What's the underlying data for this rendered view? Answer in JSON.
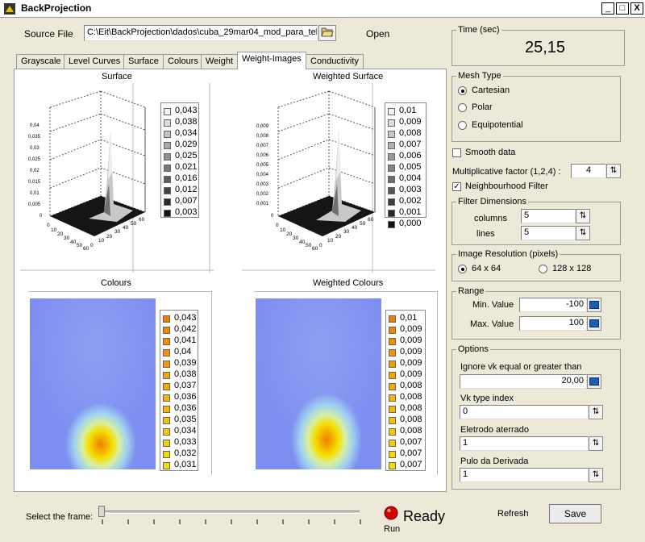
{
  "window": {
    "title": "BackProjection",
    "min": "_",
    "max": "□",
    "close": "X"
  },
  "source": {
    "label": "Source File",
    "path": "C:\\Eit\\BackProjection\\dados\\cuba_29mar04_mod_para_tel",
    "open_label": "Open"
  },
  "tabs": [
    "Grayscale",
    "Level Curves",
    "Surface",
    "Colours",
    "Weight",
    "Weight-Images",
    "Conductivity"
  ],
  "active_tab": "Weight-Images",
  "plots": {
    "surface": {
      "title": "Surface",
      "legend": [
        "0,043",
        "0,038",
        "0,034",
        "0,029",
        "0,025",
        "0,021",
        "0,016",
        "0,012",
        "0,007",
        "0,003"
      ],
      "zticks": [
        "0,04",
        "0,035",
        "0,03",
        "0,025",
        "0,02",
        "0,015",
        "0,01",
        "0,005",
        "0"
      ],
      "xticks": [
        "0",
        "10",
        "20",
        "30",
        "40",
        "50",
        "60"
      ],
      "yticks": [
        "0",
        "10",
        "20",
        "30",
        "40",
        "50",
        "60"
      ]
    },
    "weighted_surface": {
      "title": "Weighted Surface",
      "legend": [
        "0,01",
        "0,009",
        "0,008",
        "0,007",
        "0,006",
        "0,005",
        "0,004",
        "0,003",
        "0,002",
        "0,001",
        "0,000"
      ],
      "zticks": [
        "0,009",
        "0,008",
        "0,007",
        "0,006",
        "0,005",
        "0,004",
        "0,003",
        "0,002",
        "0,001",
        "0"
      ],
      "xticks": [
        "0",
        "10",
        "20",
        "30",
        "40",
        "50",
        "60"
      ],
      "yticks": [
        "0",
        "10",
        "20",
        "30",
        "40",
        "50",
        "60"
      ]
    },
    "colours": {
      "title": "Colours",
      "legend": [
        "0,043",
        "0,042",
        "0,041",
        "0,04",
        "0,039",
        "0,038",
        "0,037",
        "0,036",
        "0,036",
        "0,035",
        "0,034",
        "0,033",
        "0,032",
        "0,031"
      ]
    },
    "weighted_colours": {
      "title": "Weighted Colours",
      "legend": [
        "0,01",
        "0,009",
        "0,009",
        "0,009",
        "0,009",
        "0,009",
        "0,008",
        "0,008",
        "0,008",
        "0,008",
        "0,008",
        "0,007",
        "0,007",
        "0,007"
      ]
    }
  },
  "colors": {
    "gray_top": "#f4f4f4",
    "gray_bottom": "#111111",
    "orange": "#f08000",
    "yellow": "#f4e000",
    "blue_bg": "#7f8ff0"
  },
  "time": {
    "label": "Time (sec)",
    "value": "25,15"
  },
  "mesh": {
    "label": "Mesh Type",
    "options": [
      "Cartesian",
      "Polar",
      "Equipotential"
    ],
    "selected": "Cartesian"
  },
  "smooth": {
    "label": "Smooth data",
    "checked": false
  },
  "multiplicative": {
    "label": "Multiplicative factor (1,2,4) :",
    "value": "4"
  },
  "neighbourhood": {
    "label": "Neighbourhood Filter",
    "checked": true
  },
  "filter": {
    "label": "Filter Dimensions",
    "columns_label": "columns",
    "columns": "5",
    "lines_label": "lines",
    "lines": "5"
  },
  "resolution": {
    "label": "Image Resolution (pixels)",
    "options": [
      "64 x 64",
      "128 x 128"
    ],
    "selected": "64 x 64"
  },
  "range": {
    "label": "Range",
    "min_label": "Min. Value",
    "min": "-100",
    "max_label": "Max. Value",
    "max": "100"
  },
  "options": {
    "label": "Options",
    "ignore_label": "Ignore vk equal or greater than",
    "ignore": "20,00",
    "vk_label": "Vk type index",
    "vk": "0",
    "eletrodo_label": "Eletrodo aterrado",
    "eletrodo": "1",
    "pulo_label": "Pulo da Derivada",
    "pulo": "1"
  },
  "footer": {
    "frame_label": "Select the frame:",
    "status": "Ready",
    "run": "Run",
    "refresh": "Refresh",
    "save": "Save",
    "frame_pos": 0
  }
}
